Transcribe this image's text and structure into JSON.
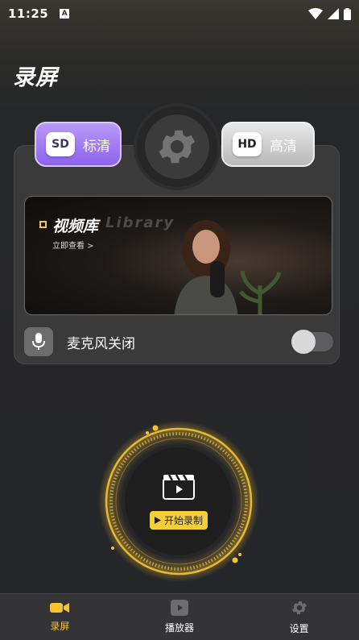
{
  "status": {
    "time": "11:25",
    "notif_letter": "A"
  },
  "page": {
    "title": "录屏"
  },
  "quality": {
    "sd_badge": "SD",
    "sd_label": "标清",
    "hd_badge": "HD",
    "hd_label": "高清",
    "selected": "SD"
  },
  "library": {
    "title": "视频库",
    "watermark": "Library",
    "subtitle": "立即查看 >"
  },
  "mic": {
    "label": "麦克风关闭",
    "enabled": false
  },
  "record": {
    "button_label": "开始录制"
  },
  "tabs": [
    {
      "label": "录屏",
      "icon": "video-camera-icon",
      "active": true
    },
    {
      "label": "播放器",
      "icon": "player-icon",
      "active": false
    },
    {
      "label": "设置",
      "icon": "gear-icon",
      "active": false
    }
  ],
  "colors": {
    "accent": "#f5c530",
    "sd_purple": "#8d63ee",
    "background": "#252629"
  }
}
